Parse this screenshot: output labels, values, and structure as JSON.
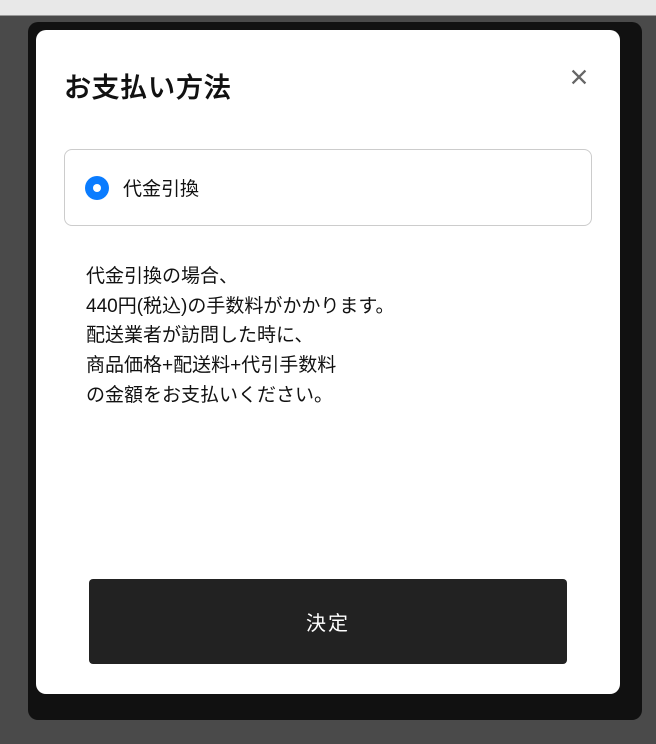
{
  "modal": {
    "title": "お支払い方法",
    "options": [
      {
        "label": "代金引換",
        "selected": true
      }
    ],
    "description": {
      "line1": "代金引換の場合、",
      "line2": "440円(税込)の手数料がかかります。",
      "line3": "配送業者が訪問した時に、",
      "line4": "商品価格+配送料+代引手数料",
      "line5": "の金額をお支払いください。"
    },
    "submit_label": "決定"
  }
}
